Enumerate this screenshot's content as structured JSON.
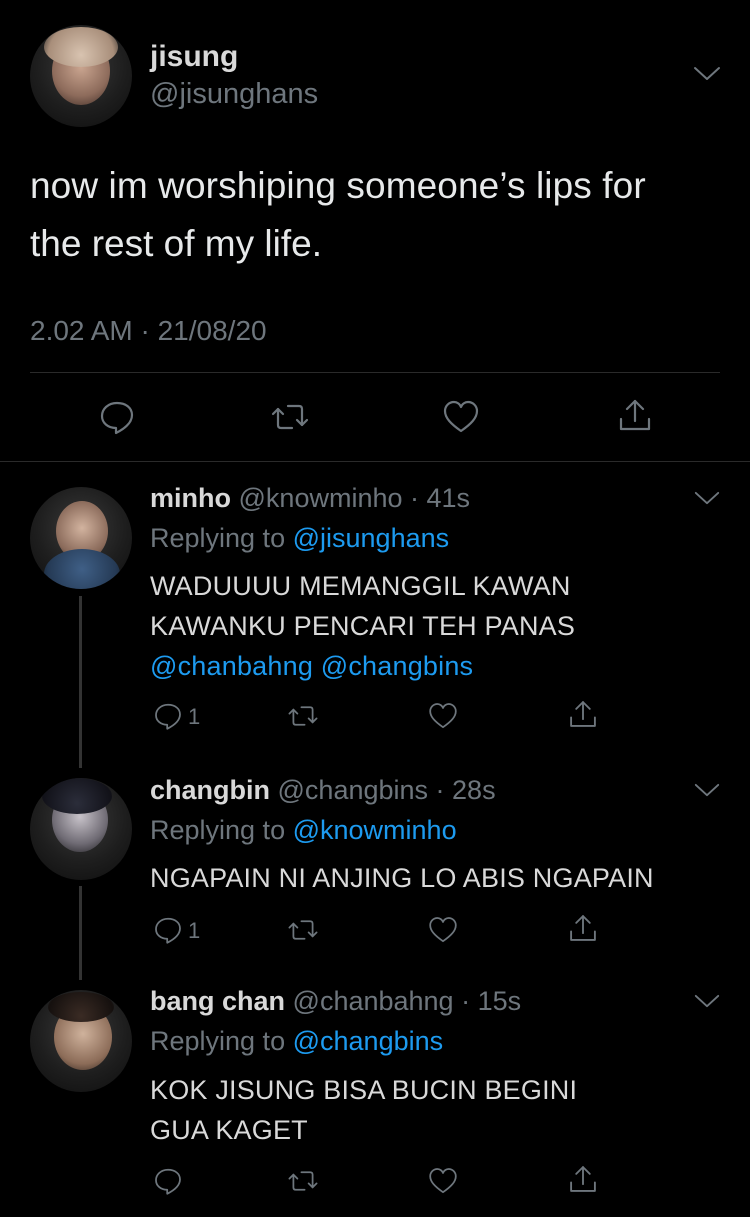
{
  "main_tweet": {
    "display_name": "jisung",
    "handle": "@jisunghans",
    "text_line1": "now im worshiping someone’s lips for",
    "text_line2": "the rest of my life.",
    "timestamp": "2.02 AM · 21/08/20"
  },
  "replies": [
    {
      "display_name": "minho",
      "handle": "@knowminho",
      "time": "· 41s",
      "replying_prefix": "Replying to",
      "replying_to": "@jisunghans",
      "line1": "WADUUUU MEMANGGIL KAWAN",
      "line2": "KAWANKU PENCARI TEH PANAS",
      "mention1": "@chanbahng",
      "mention2": "@changbins",
      "reply_count": "1"
    },
    {
      "display_name": "changbin",
      "handle": "@changbins",
      "time": "· 28s",
      "replying_prefix": "Replying to",
      "replying_to": "@knowminho",
      "line1": "NGAPAIN NI ANJING LO ABIS NGAPAIN",
      "reply_count": "1"
    },
    {
      "display_name": "bang chan",
      "handle": "@chanbahng",
      "time": "· 15s",
      "replying_prefix": "Replying to",
      "replying_to": "@changbins",
      "line1": "KOK JISUNG BISA BUCIN BEGINI",
      "line2": "GUA KAGET"
    }
  ],
  "icons": [
    "chevron-down-icon",
    "reply-icon",
    "retweet-icon",
    "like-icon",
    "share-icon"
  ],
  "colors": {
    "background": "#000000",
    "text": "#d9d9d9",
    "muted": "#6e767d",
    "link": "#1d9bf0"
  }
}
